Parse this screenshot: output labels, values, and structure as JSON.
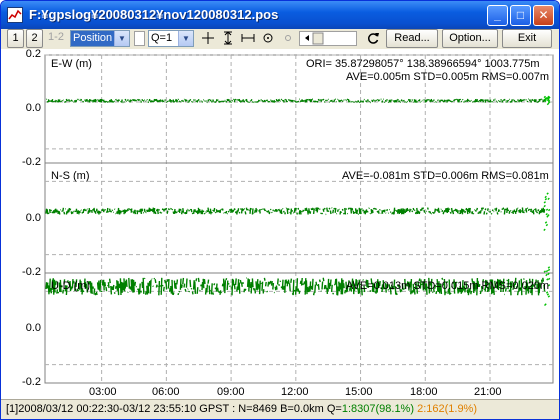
{
  "window": {
    "title": "F:¥gpslog¥20080312¥nov120080312.pos",
    "buttons": {
      "minimize": "_",
      "maximize": "□",
      "close": "✕"
    }
  },
  "toolbar": {
    "b1": "1",
    "b2": "2",
    "b12": "1-2",
    "plot_type": "Position",
    "quality": "Q=1",
    "read": "Read...",
    "option": "Option...",
    "exit": "Exit"
  },
  "plot": {
    "header": "ORI= 35.87298057° 138.38966594° 1003.775m",
    "panels": [
      {
        "label": "E-W (m)",
        "stats": "AVE=0.005m STD=0.005m RMS=0.007m",
        "ave": 0.005,
        "std": 0.005
      },
      {
        "label": "N-S (m)",
        "stats": "AVE=-0.081m STD=0.006m RMS=0.081m",
        "ave": -0.081,
        "std": 0.006
      },
      {
        "label": "U-D (m)",
        "stats": "AVE=0.013m STD=0.015m RMS=0.020m",
        "ave": 0.013,
        "std": 0.015
      }
    ],
    "yticks": [
      [
        "0.2",
        "0.0",
        "-0.2"
      ],
      [
        "0.0",
        "-0.2"
      ],
      [
        "0.0",
        "-0.2"
      ]
    ],
    "xticks": [
      "03:00",
      "06:00",
      "09:00",
      "12:00",
      "15:00",
      "18:00",
      "21:00"
    ],
    "series_color": "#008000",
    "spike_color": "#00c000",
    "grid_color": "#b0b0b0"
  },
  "status": {
    "text": "[1]2008/03/12 00:22:30-03/12 23:55:10 GPST : N=8469 B=0.0km Q=",
    "q1": "1:8307(98.1%)",
    "q2": "2:162(1.9%)",
    "q1_color": "#008000",
    "q2_color": "#e08000"
  }
}
